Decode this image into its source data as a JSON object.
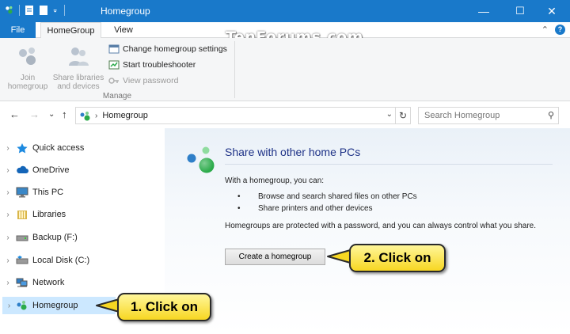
{
  "window": {
    "title": "Homegroup",
    "controls": {
      "minimize": "—",
      "maximize": "☐",
      "close": "✕"
    }
  },
  "ribbon": {
    "tabs": [
      {
        "label": "File"
      },
      {
        "label": "HomeGroup"
      },
      {
        "label": "View"
      }
    ],
    "collapse_glyph": "⌃",
    "help_glyph": "?",
    "groups": [
      {
        "label": "Manage",
        "big_buttons": [
          {
            "label": "Join\nhomegroup",
            "icon": "homegroup-join-icon"
          },
          {
            "label": "Share libraries\nand devices",
            "icon": "share-users-icon"
          }
        ],
        "small_buttons": [
          {
            "label": "Change homegroup settings",
            "icon": "settings-window-icon",
            "enabled": true
          },
          {
            "label": "Start troubleshooter",
            "icon": "troubleshooter-icon",
            "enabled": true
          },
          {
            "label": "View password",
            "icon": "key-icon",
            "enabled": false
          }
        ]
      }
    ]
  },
  "watermark": "TenForums.com",
  "address_bar": {
    "back_glyph": "←",
    "forward_glyph": "→",
    "recent_glyph": "⌄",
    "up_glyph": "↑",
    "path": [
      "Homegroup"
    ],
    "separator": "›",
    "refresh_glyph": "↻",
    "dropdown_glyph": "⌄"
  },
  "search": {
    "placeholder": "Search Homegroup",
    "icon_glyph": "⚲"
  },
  "nav_pane": {
    "items": [
      {
        "label": "Quick access",
        "icon": "star-icon",
        "color": "#1d8ae0"
      },
      {
        "label": "OneDrive",
        "icon": "cloud-icon",
        "color": "#1465b8"
      },
      {
        "label": "This PC",
        "icon": "monitor-icon",
        "color": "#3a87c7"
      },
      {
        "label": "Libraries",
        "icon": "library-icon",
        "color": "#d9b64a"
      },
      {
        "label": "Backup (F:)",
        "icon": "drive-icon",
        "color": "#8a8a8a"
      },
      {
        "label": "Local Disk (C:)",
        "icon": "drive-icon",
        "color": "#8a8a8a"
      },
      {
        "label": "Network",
        "icon": "network-icon",
        "color": "#2f7fc8"
      },
      {
        "label": "Homegroup",
        "icon": "homegroup-icon",
        "color": "#2bab4a",
        "selected": true
      }
    ],
    "expand_glyph": "›"
  },
  "content": {
    "heading": "Share with other home PCs",
    "intro": "With a homegroup, you can:",
    "bullets": [
      "Browse and search shared files on other PCs",
      "Share printers and other devices"
    ],
    "bullet_glyph": "•",
    "protected_text": "Homegroups are protected with a password, and you can always control what you share.",
    "create_button": "Create a homegroup"
  },
  "callouts": [
    {
      "label": "1. Click on"
    },
    {
      "label": "2. Click on"
    }
  ],
  "colors": {
    "titlebar": "#1979ca",
    "heading": "#1e3287",
    "selection": "#cce8ff",
    "callout": "#f7d722"
  }
}
